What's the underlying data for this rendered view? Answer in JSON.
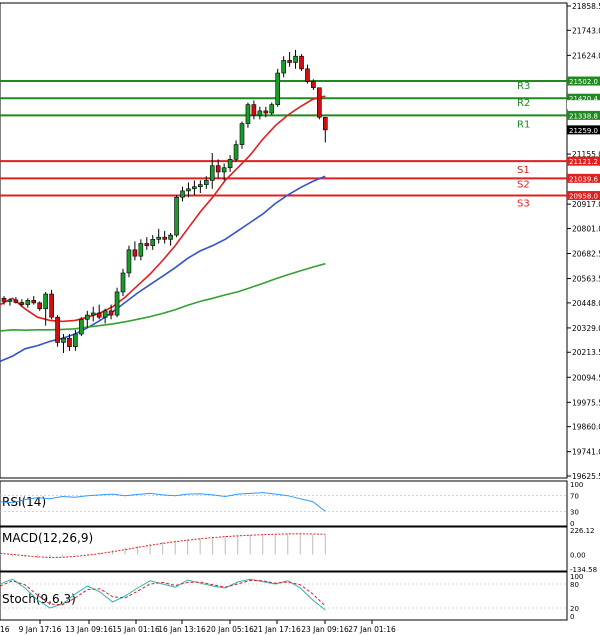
{
  "chart_data": [
    {
      "type": "candlestick",
      "panel": "price",
      "ylim": [
        19625.5,
        21858.5
      ],
      "ytick_labels": [
        "21858.5",
        "21743.0",
        "21624.0",
        "21505.5",
        "21389.5",
        "21271.5",
        "21155.0",
        "21036.0",
        "20917.0",
        "20801.0",
        "20682.5",
        "20563.5",
        "20448.0",
        "20329.0",
        "20213.5",
        "20094.5",
        "19975.5",
        "19860.0",
        "19741.0",
        "19625.5"
      ],
      "ytick_values": [
        21858.5,
        21743.0,
        21624.0,
        21505.5,
        21389.5,
        21271.5,
        21155.0,
        21036.0,
        20917.0,
        20801.0,
        20682.5,
        20563.5,
        20448.0,
        20329.0,
        20213.5,
        20094.5,
        19975.5,
        19860.0,
        19741.0,
        19625.5
      ],
      "xtick_labels": [
        "9 Jan 17:16",
        "13 Jan 09:16",
        "15 Jan 01:16",
        "16 Jan 13:16",
        "20 Jan 05:16",
        "21 Jan 17:16",
        "23 Jan 09:16",
        "27 Jan 01:16"
      ],
      "xtick_first_fragment": "16",
      "candles": [
        [
          20470,
          20480,
          20440,
          20455
        ],
        [
          20455,
          20470,
          20435,
          20462
        ],
        [
          20462,
          20475,
          20445,
          20450
        ],
        [
          20450,
          20465,
          20430,
          20440
        ],
        [
          20440,
          20470,
          20425,
          20460
        ],
        [
          20460,
          20480,
          20440,
          20448
        ],
        [
          20448,
          20455,
          20410,
          20420
        ],
        [
          20420,
          20500,
          20340,
          20490
        ],
        [
          20490,
          20510,
          20370,
          20380
        ],
        [
          20380,
          20390,
          20240,
          20260
        ],
        [
          20260,
          20300,
          20210,
          20280
        ],
        [
          20280,
          20300,
          20220,
          20240
        ],
        [
          20240,
          20320,
          20220,
          20300
        ],
        [
          20300,
          20380,
          20290,
          20370
        ],
        [
          20370,
          20410,
          20330,
          20390
        ],
        [
          20390,
          20430,
          20360,
          20400
        ],
        [
          20400,
          20440,
          20370,
          20380
        ],
        [
          20380,
          20420,
          20350,
          20410
        ],
        [
          20410,
          20440,
          20370,
          20390
        ],
        [
          20390,
          20520,
          20380,
          20500
        ],
        [
          20500,
          20610,
          20480,
          20590
        ],
        [
          20590,
          20720,
          20570,
          20700
        ],
        [
          20700,
          20740,
          20650,
          20670
        ],
        [
          20670,
          20750,
          20650,
          20730
        ],
        [
          20730,
          20760,
          20700,
          20720
        ],
        [
          20720,
          20770,
          20700,
          20750
        ],
        [
          20750,
          20800,
          20730,
          20760
        ],
        [
          20760,
          20790,
          20730,
          20750
        ],
        [
          20750,
          20780,
          20720,
          20770
        ],
        [
          20770,
          20960,
          20760,
          20950
        ],
        [
          20950,
          21000,
          20930,
          20980
        ],
        [
          20980,
          21020,
          20950,
          20990
        ],
        [
          20990,
          21030,
          20960,
          21000
        ],
        [
          21000,
          21030,
          20970,
          21010
        ],
        [
          21010,
          21050,
          20990,
          21030
        ],
        [
          21030,
          21160,
          20990,
          21100
        ],
        [
          21100,
          21130,
          21040,
          21070
        ],
        [
          21070,
          21110,
          21030,
          21090
        ],
        [
          21090,
          21150,
          21070,
          21130
        ],
        [
          21130,
          21220,
          21120,
          21200
        ],
        [
          21200,
          21310,
          21180,
          21300
        ],
        [
          21300,
          21400,
          21280,
          21390
        ],
        [
          21390,
          21410,
          21320,
          21340
        ],
        [
          21340,
          21380,
          21320,
          21360
        ],
        [
          21360,
          21380,
          21330,
          21350
        ],
        [
          21350,
          21400,
          21340,
          21390
        ],
        [
          21390,
          21560,
          21380,
          21540
        ],
        [
          21540,
          21620,
          21520,
          21600
        ],
        [
          21600,
          21640,
          21570,
          21590
        ],
        [
          21590,
          21650,
          21560,
          21620
        ],
        [
          21620,
          21630,
          21550,
          21560
        ],
        [
          21560,
          21580,
          21490,
          21500
        ],
        [
          21500,
          21510,
          21460,
          21470
        ],
        [
          21470,
          21420,
          21320,
          21330
        ],
        [
          21330,
          21310,
          21210,
          21270
        ]
      ],
      "levels": [
        {
          "name": "R3",
          "label": "R3",
          "value": 21502.0,
          "price_tag": "21502.0",
          "color": "#1f8a1f"
        },
        {
          "name": "R2",
          "label": "R2",
          "value": 21420.4,
          "price_tag": "21420.4",
          "color": "#1f8a1f"
        },
        {
          "name": "R1",
          "label": "R1",
          "value": 21338.8,
          "price_tag": "21338.8",
          "color": "#1f8a1f"
        },
        {
          "name": "S1",
          "label": "S1",
          "value": 21121.2,
          "price_tag": "21121.2",
          "color": "#e02020"
        },
        {
          "name": "S2",
          "label": "S2",
          "value": 21039.6,
          "price_tag": "21039.6",
          "color": "#e02020"
        },
        {
          "name": "S3",
          "label": "S3",
          "value": 20958.0,
          "price_tag": "20958.0",
          "color": "#e02020"
        }
      ],
      "current_price_tag": "21259.0",
      "grey_tag": "21389.5",
      "moving_averages": [
        {
          "color": "#e02020",
          "values": [
            20440,
            20470,
            20420,
            20380,
            20365,
            20360,
            20365,
            20380,
            20400,
            20430,
            20475,
            20530,
            20585,
            20650,
            20720,
            20800,
            20880,
            20950,
            21030,
            21090,
            21150,
            21225,
            21290,
            21340,
            21380,
            21415,
            21430
          ]
        },
        {
          "color": "#3355cc",
          "values": [
            20170,
            20195,
            20230,
            20245,
            20265,
            20280,
            20300,
            20330,
            20365,
            20405,
            20450,
            20495,
            20535,
            20575,
            20615,
            20660,
            20695,
            20720,
            20750,
            20790,
            20830,
            20870,
            20920,
            20960,
            20995,
            21025,
            21050
          ]
        },
        {
          "color": "#33a033",
          "values": [
            20315,
            20320,
            20318,
            20320,
            20320,
            20322,
            20325,
            20333,
            20340,
            20348,
            20358,
            20370,
            20383,
            20398,
            20415,
            20437,
            20455,
            20470,
            20486,
            20500,
            20520,
            20540,
            20562,
            20582,
            20600,
            20618,
            20634
          ]
        }
      ]
    },
    {
      "type": "line",
      "panel": "rsi",
      "label": "RSI(14)",
      "ticks": [
        "100",
        "70",
        "30",
        "0"
      ],
      "ylim": [
        0,
        100
      ],
      "color": "#3399ff",
      "values": [
        55,
        52,
        60,
        65,
        62,
        68,
        66,
        70,
        72,
        74,
        70,
        73,
        76,
        72,
        70,
        74,
        75,
        72,
        68,
        74,
        76,
        78,
        74,
        70,
        62,
        55,
        30
      ]
    },
    {
      "type": "histogram",
      "panel": "macd",
      "label": "MACD(12,26,9)",
      "ticks": [
        "226.12",
        "0.00",
        "-134.58"
      ],
      "ylim": [
        -134.58,
        226.12
      ],
      "values": [
        -5,
        -15,
        -25,
        -35,
        -30,
        -20,
        -10,
        5,
        20,
        40,
        60,
        80,
        100,
        115,
        130,
        145,
        155,
        165,
        172,
        178,
        182,
        186,
        190,
        192,
        190,
        185,
        180
      ],
      "signal_color": "#e02020",
      "signal": [
        10,
        0,
        -12,
        -22,
        -28,
        -26,
        -18,
        -6,
        8,
        25,
        45,
        65,
        85,
        102,
        118,
        132,
        145,
        156,
        165,
        172,
        178,
        183,
        187,
        190,
        191,
        189,
        186
      ]
    },
    {
      "type": "line",
      "panel": "stoch",
      "label": "Stoch(9,6,3)",
      "ticks": [
        "100",
        "80",
        "20",
        "0"
      ],
      "ylim": [
        0,
        100
      ],
      "series": [
        {
          "color": "#2bb5b5",
          "values": [
            80,
            92,
            70,
            40,
            20,
            30,
            55,
            75,
            60,
            35,
            50,
            70,
            88,
            80,
            72,
            90,
            82,
            75,
            70,
            85,
            92,
            86,
            80,
            88,
            70,
            40,
            15
          ]
        },
        {
          "color": "#e02020",
          "values": [
            75,
            88,
            78,
            52,
            30,
            28,
            45,
            66,
            68,
            48,
            45,
            62,
            80,
            84,
            76,
            84,
            85,
            78,
            72,
            80,
            89,
            88,
            82,
            85,
            78,
            55,
            25
          ]
        }
      ]
    }
  ]
}
